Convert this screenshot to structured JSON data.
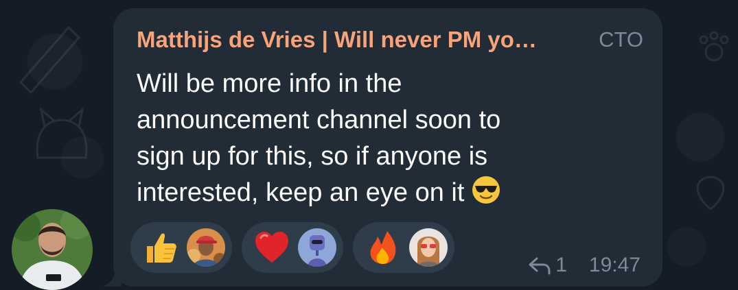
{
  "message": {
    "sender_name": "Matthijs de Vries | Will never PM yo…",
    "sender_role": "CTO",
    "text": "Will be more info in the\nannouncement channel soon to\nsign up for this, so if anyone is\ninterested, keep an eye on it",
    "trailing_emoji": "smiling-face-with-sunglasses",
    "reply_count": "1",
    "time": "19:47"
  },
  "reactions": [
    {
      "emoji": "thumbs-up",
      "reactor": "avatar-woman-red-cap"
    },
    {
      "emoji": "red-heart",
      "reactor": "avatar-robot-blue"
    },
    {
      "emoji": "fire",
      "reactor": "avatar-woman-red-glasses"
    }
  ],
  "colors": {
    "background": "#17212b",
    "bubble": "#212c37",
    "sender_name": "#f7a37b",
    "meta_text": "#7c8b98",
    "reaction_pill": "#2f3d4b"
  }
}
